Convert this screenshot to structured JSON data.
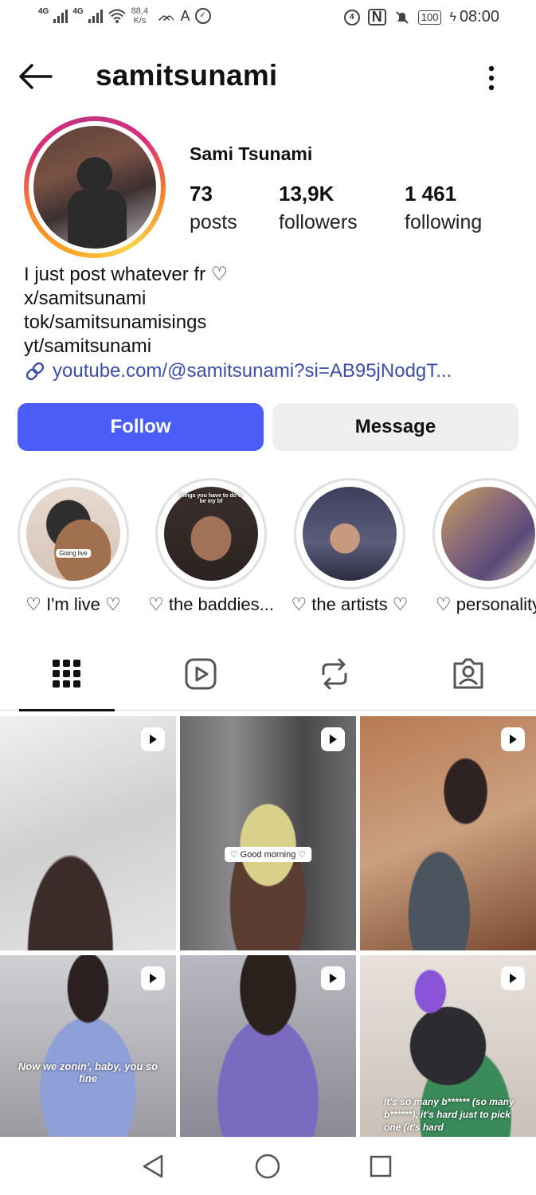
{
  "status_bar": {
    "net1": "4G",
    "net2": "4G",
    "speed_value": "88,4",
    "speed_unit": "K/s",
    "battery": "100",
    "time": "08:00"
  },
  "header": {
    "username": "samitsunami"
  },
  "profile": {
    "display_name": "Sami Tsunami",
    "stats": [
      {
        "value": "73",
        "label": "posts"
      },
      {
        "value": "13,9K",
        "label": "followers"
      },
      {
        "value": "1 461",
        "label": "following"
      }
    ],
    "bio": [
      "I just post whatever fr ♡",
      "x/samitsunami",
      "tok/samitsunamisings",
      "yt/samitsunami"
    ],
    "link": "youtube.com/@samitsunami?si=AB95jNodgT..."
  },
  "buttons": {
    "follow": "Follow",
    "message": "Message"
  },
  "highlights": [
    {
      "label": "♡ I'm live ♡",
      "caption": "Going live"
    },
    {
      "label": "♡ the baddies...",
      "caption": "things you have to do to be my bf"
    },
    {
      "label": "♡ the artists ♡",
      "caption": ""
    },
    {
      "label": "♡ personality",
      "caption": ""
    }
  ],
  "tabs": [
    "grid-icon",
    "reels-icon",
    "reposts-icon",
    "tagged-icon"
  ],
  "posts": [
    {
      "caption": ""
    },
    {
      "caption": "♡ Good morning ♡"
    },
    {
      "caption": ""
    },
    {
      "caption": "Now we zonin', baby, you so fine"
    },
    {
      "caption": ""
    },
    {
      "caption": "It's so many b****** (so many b******), it's hard just to pick one (it's hard"
    }
  ],
  "colors": {
    "follow_button": "#4a5ef7",
    "message_button": "#efeff2",
    "link": "#3b4fa8"
  }
}
